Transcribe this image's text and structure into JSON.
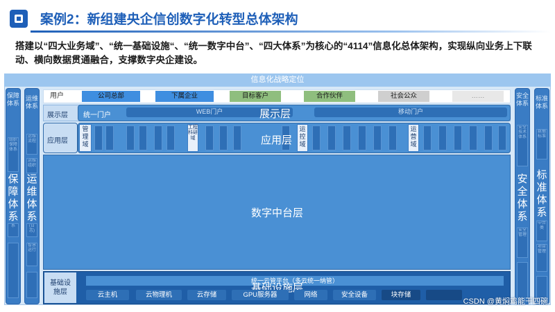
{
  "header": {
    "title": "案例2：新组建央企信创数字化转型总体架构",
    "subtitle": "搭建以“四大业务域”、“统一基础设施“、“统一数字中台”、“四大体系”为核心的“4114”信息化总体架构，实现纵向业务上下联动、横向数据贯通融合，支撑数字央企建设。"
  },
  "diagram": {
    "strategy": "信息化战略定位",
    "left_columns": [
      {
        "small": "保障体系",
        "big": "保障体系",
        "minis": [
          "组织保障体系",
          "系"
        ]
      },
      {
        "small": "运维体系",
        "big": "运维体系",
        "minis": [
          "运维流程",
          "运维组织",
          "(日志)",
          "智慧运行"
        ]
      }
    ],
    "right_columns": [
      {
        "small": "安全体系",
        "big": "安全体系",
        "minis": [
          "安全技术体系",
          "安全管理"
        ]
      },
      {
        "small": "标准体系",
        "big": "标准体系",
        "minis": [
          "数据标准",
          "规范",
          "中台类",
          "项目管理",
          "规范"
        ]
      }
    ],
    "users": {
      "label": "用户",
      "items": [
        {
          "label": "公司总部",
          "color": "#3f8ee0"
        },
        {
          "label": "下属企业",
          "color": "#3f8ee0"
        },
        {
          "label": "目标客户",
          "color": "#8fbe7e"
        },
        {
          "label": "合作伙伴",
          "color": "#8fbe7e"
        },
        {
          "label": "社会公众",
          "color": "#cfcfcf"
        },
        {
          "label": "……",
          "color": "#e8e8e8"
        }
      ]
    },
    "presentation": {
      "label": "展示层",
      "title": "展示层",
      "portal": "统一门户",
      "web": "WEB门户",
      "mobile": "移动门户"
    },
    "application": {
      "label": "应用层",
      "title": "应用层",
      "domains": [
        {
          "name": "管理域"
        },
        {
          "name": "工程科研域"
        },
        {
          "name": "运控域"
        },
        {
          "name": "运营域"
        }
      ]
    },
    "middle": {
      "title": "数字中台层"
    },
    "infrastructure": {
      "label": "基础设施层",
      "title": "基础设施层",
      "cloud": "统一云管平台（多云统一纳管）",
      "items": [
        "云主机",
        "云物理机",
        "云存储",
        "GPU服务器",
        "网络",
        "安全设备",
        "块存储"
      ]
    }
  },
  "watermark": "CSDN @黄焖鸡能干四碗",
  "colors": {
    "primary": "#1e5fb8",
    "layer": "#4a90d4",
    "side": "#3a7cc4"
  }
}
